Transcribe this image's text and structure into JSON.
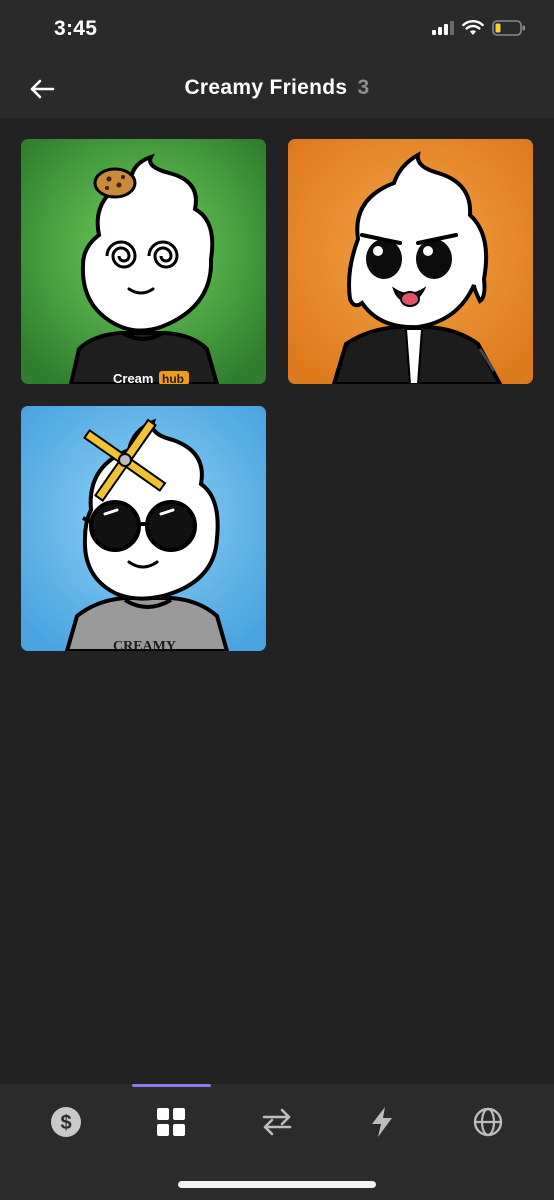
{
  "status_bar": {
    "time": "3:45",
    "icons": [
      "signal-icon",
      "wifi-icon",
      "battery-icon"
    ]
  },
  "nav": {
    "back_icon": "back-arrow-icon",
    "title": "Creamy Friends",
    "count": "3"
  },
  "collection": {
    "items": [
      {
        "background": "#3e9a3c",
        "shirt_text": "Cream hub",
        "accessory": "cookie"
      },
      {
        "background": "#ee8f2e",
        "shirt_text": "",
        "accessory": "black jacket"
      },
      {
        "background": "#55aee6",
        "shirt_text": "CREAMY",
        "accessory": "pencils and sunglasses"
      }
    ]
  },
  "tab_bar": {
    "tabs": [
      {
        "icon": "dollar-icon",
        "active": false
      },
      {
        "icon": "grid-icon",
        "active": true
      },
      {
        "icon": "transfer-icon",
        "active": false
      },
      {
        "icon": "lightning-icon",
        "active": false
      },
      {
        "icon": "globe-icon",
        "active": false
      }
    ],
    "active_color": "#8a7cf0"
  }
}
